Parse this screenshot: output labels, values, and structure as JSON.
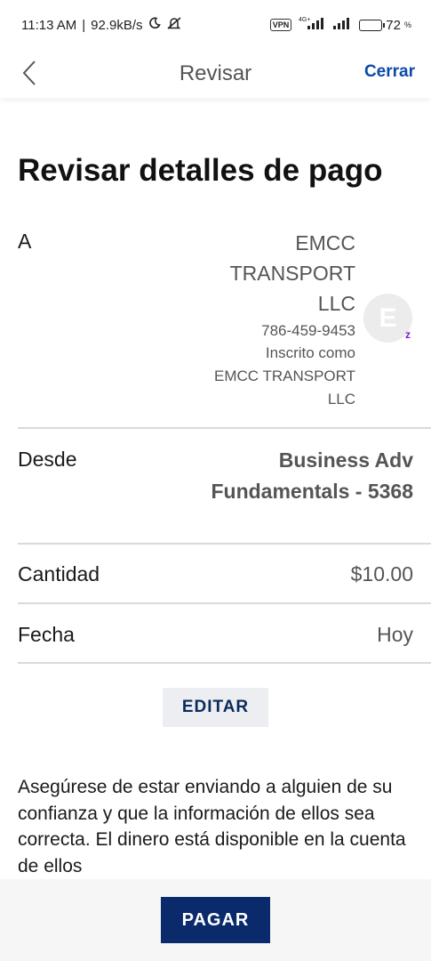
{
  "status_bar": {
    "time": "11:13 AM",
    "net_speed": "92.9kB/s",
    "vpn": "VPN",
    "network": "4G+",
    "battery_percent": "72",
    "battery_level": 0.72
  },
  "header": {
    "title": "Revisar",
    "close_label": "Cerrar"
  },
  "page": {
    "title": "Revisar detalles de pago"
  },
  "recipient": {
    "label": "A",
    "name_line1": "EMCC",
    "name_line2": "TRANSPORT",
    "name_line3": "LLC",
    "phone": "786-459-9453",
    "enrolled_line1": "Inscrito como",
    "enrolled_line2": "EMCC TRANSPORT",
    "enrolled_line3": "LLC",
    "avatar_letter": "E",
    "badge": "z"
  },
  "from": {
    "label": "Desde",
    "value_line1": "Business Adv",
    "value_line2": "Fundamentals - 5368"
  },
  "amount": {
    "label": "Cantidad",
    "value": "$10.00"
  },
  "date": {
    "label": "Fecha",
    "value": "Hoy"
  },
  "actions": {
    "edit_label": "EDITAR",
    "pay_label": "PAGAR"
  },
  "disclaimer": "Asegúrese de estar enviando a alguien de su confianza y que la información de ellos sea correcta. El dinero está disponible en la cuenta de ellos",
  "colors": {
    "accent": "#0a4aa6",
    "pay_button": "#0a2a6b",
    "zelle_purple": "#6d1ed4"
  }
}
